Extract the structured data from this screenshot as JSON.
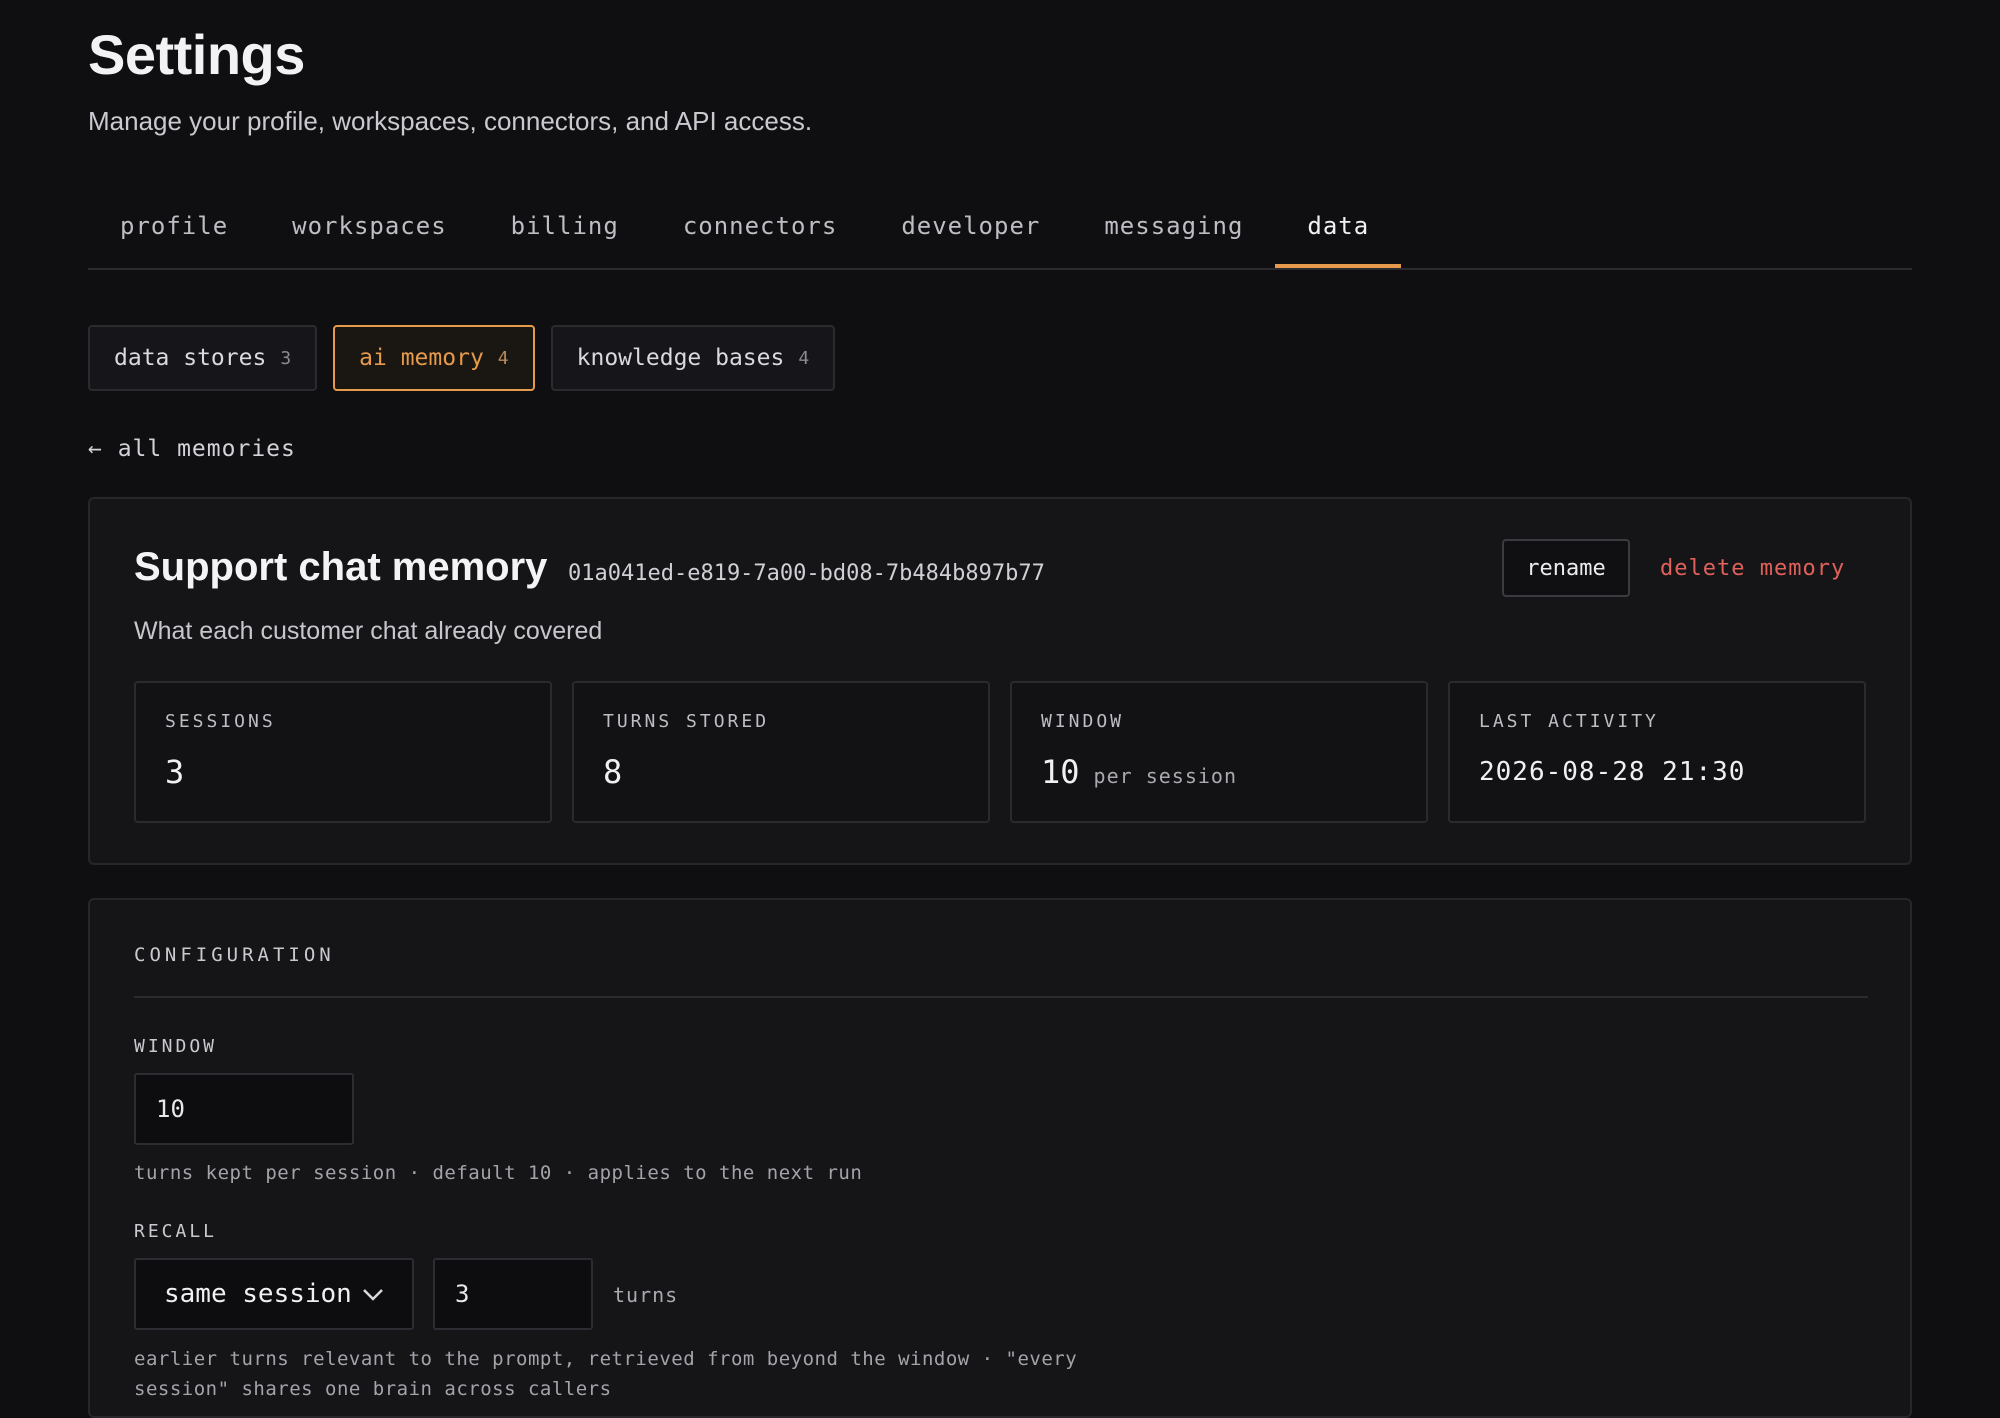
{
  "header": {
    "title": "Settings",
    "subtitle": "Manage your profile, workspaces, connectors, and API access."
  },
  "tabs": [
    {
      "label": "profile"
    },
    {
      "label": "workspaces"
    },
    {
      "label": "billing"
    },
    {
      "label": "connectors"
    },
    {
      "label": "developer"
    },
    {
      "label": "messaging"
    },
    {
      "label": "data",
      "active": true
    }
  ],
  "subtabs": [
    {
      "label": "data stores",
      "count": "3"
    },
    {
      "label": "ai memory",
      "count": "4",
      "active": true
    },
    {
      "label": "knowledge bases",
      "count": "4"
    }
  ],
  "back_link": "← all memories",
  "memory": {
    "name": "Support chat memory",
    "id": "01a041ed-e819-7a00-bd08-7b484b897b77",
    "description": "What each customer chat already covered",
    "rename_label": "rename",
    "delete_label": "delete memory"
  },
  "stats": {
    "sessions": {
      "label": "SESSIONS",
      "value": "3"
    },
    "turns_stored": {
      "label": "TURNS STORED",
      "value": "8"
    },
    "window": {
      "label": "WINDOW",
      "value": "10",
      "unit": "per session"
    },
    "last_activity": {
      "label": "LAST ACTIVITY",
      "value": "2026-08-28 21:30"
    }
  },
  "config": {
    "section_label": "CONFIGURATION",
    "window": {
      "label": "WINDOW",
      "value": "10",
      "hint": "turns kept per session · default 10 · applies to the next run"
    },
    "recall": {
      "label": "RECALL",
      "mode": "same session",
      "turns_value": "3",
      "turns_unit": "turns",
      "hint_line1": "earlier turns relevant to the prompt, retrieved from beyond the window · \"every",
      "hint_line2": "session\" shares one brain across callers"
    }
  },
  "colors": {
    "accent": "#e59a4c",
    "danger": "#e0605a",
    "background": "#0f0f11"
  },
  "icons": {
    "back": "arrow-left-icon",
    "dropdown": "chevron-down-icon"
  }
}
